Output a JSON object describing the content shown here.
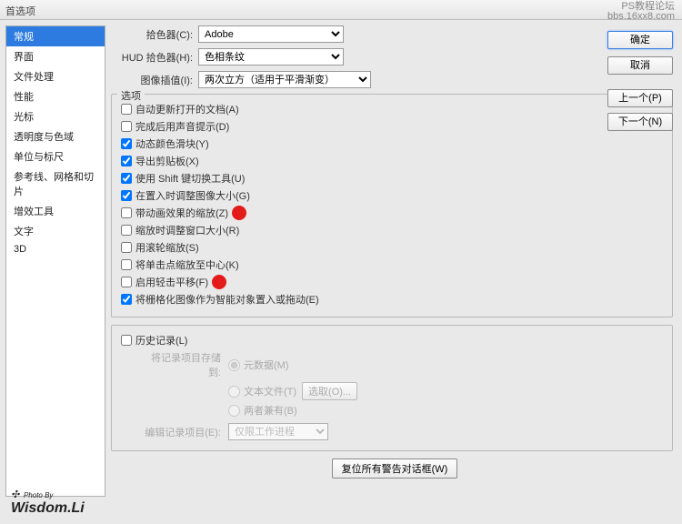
{
  "titlebar": "首选项",
  "watermark": {
    "line1": "PS教程论坛",
    "line2": "bbs.16xx8.com"
  },
  "sidebar": {
    "items": [
      {
        "label": "常规",
        "selected": true
      },
      {
        "label": "界面"
      },
      {
        "label": "文件处理"
      },
      {
        "label": "性能"
      },
      {
        "label": "光标"
      },
      {
        "label": "透明度与色域"
      },
      {
        "label": "单位与标尺"
      },
      {
        "label": "参考线、网格和切片"
      },
      {
        "label": "增效工具"
      },
      {
        "label": "文字"
      },
      {
        "label": "3D"
      }
    ]
  },
  "pickers": {
    "color_label": "拾色器(C):",
    "color_value": "Adobe",
    "hud_label": "HUD 拾色器(H):",
    "hud_value": "色相条纹",
    "interp_label": "图像插值(I):",
    "interp_value": "两次立方（适用于平滑渐变）"
  },
  "options": {
    "legend": "选项",
    "items": [
      {
        "label": "自动更新打开的文档(A)",
        "checked": false
      },
      {
        "label": "完成后用声音提示(D)",
        "checked": false
      },
      {
        "label": "动态颜色滑块(Y)",
        "checked": true
      },
      {
        "label": "导出剪贴板(X)",
        "checked": true
      },
      {
        "label": "使用 Shift 键切换工具(U)",
        "checked": true
      },
      {
        "label": "在置入时调整图像大小(G)",
        "checked": true
      },
      {
        "label": "带动画效果的缩放(Z)",
        "checked": false,
        "dot": true
      },
      {
        "label": "缩放时调整窗口大小(R)",
        "checked": false
      },
      {
        "label": "用滚轮缩放(S)",
        "checked": false
      },
      {
        "label": "将单击点缩放至中心(K)",
        "checked": false
      },
      {
        "label": "启用轻击平移(F)",
        "checked": false,
        "dot": true
      },
      {
        "label": "将栅格化图像作为智能对象置入或拖动(E)",
        "checked": true
      }
    ]
  },
  "history": {
    "label": "历史记录(L)",
    "checked": false,
    "save_to": "将记录项目存储到:",
    "opt_meta": "元数据(M)",
    "opt_text": "文本文件(T)",
    "select_btn": "选取(O)...",
    "opt_both": "两者兼有(B)",
    "edit_label": "编辑记录项目(E):",
    "edit_value": "仅限工作进程"
  },
  "reset_btn": "复位所有警告对话框(W)",
  "buttons": {
    "ok": "确定",
    "cancel": "取消",
    "prev": "上一个(P)",
    "next": "下一个(N)"
  },
  "photo_by": {
    "small": "Photo By",
    "sig": "Wisdom.Li"
  }
}
